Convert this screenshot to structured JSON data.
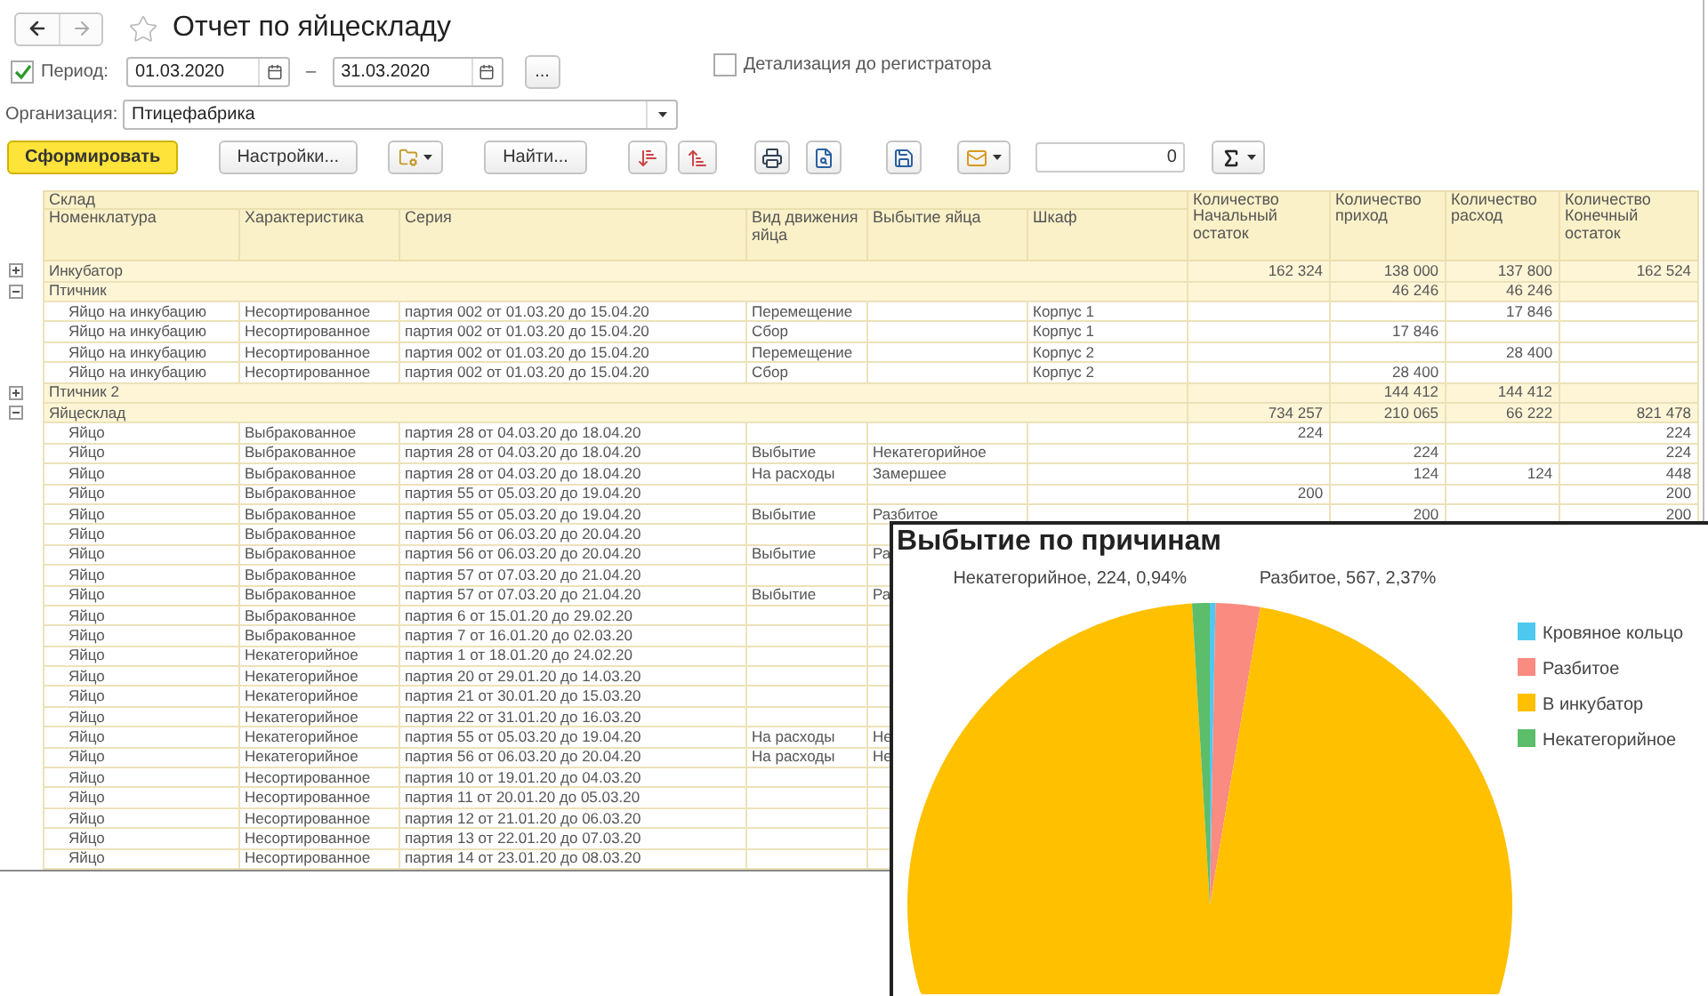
{
  "window": {
    "title": "Отчет по яйцескладу"
  },
  "period": {
    "label": "Период:",
    "checked": true,
    "from": "01.03.2020",
    "separator": "–",
    "to": "31.03.2020",
    "more_button": "..."
  },
  "detail_to_registrar": {
    "label": "Детализация до регистратора",
    "checked": false
  },
  "organization": {
    "label": "Организация:",
    "value": "Птицефабрика"
  },
  "toolbar": {
    "generate": "Сформировать",
    "settings": "Настройки...",
    "find": "Найти...",
    "sum_field": "0"
  },
  "table": {
    "group_header": "Склад",
    "columns": [
      "Номенклатура",
      "Характеристика",
      "Серия",
      "Вид движения яйца",
      "Выбытие яйца",
      "Шкаф",
      "Количество Начальный остаток",
      "Количество приход",
      "Количество расход",
      "Количество Конечный остаток"
    ],
    "rows": [
      {
        "kind": "group",
        "label": "Инкубатор",
        "expanded": false,
        "qty_start": "162 324",
        "qty_in": "138 000",
        "qty_out": "137 800",
        "qty_end": "162 524"
      },
      {
        "kind": "group",
        "label": "Птичник",
        "expanded": true,
        "qty_in": "46 246",
        "qty_out": "46 246"
      },
      {
        "kind": "item",
        "nomenclature": "Яйцо на инкубацию",
        "characteristic": "Несортированное",
        "series": "партия  002 от 01.03.20 до 15.04.20",
        "movement": "Перемещение",
        "cabinet": "Корпус 1",
        "qty_out": "17 846"
      },
      {
        "kind": "item",
        "nomenclature": "Яйцо на инкубацию",
        "characteristic": "Несортированное",
        "series": "партия  002 от 01.03.20 до 15.04.20",
        "movement": "Сбор",
        "cabinet": "Корпус 1",
        "qty_in": "17 846"
      },
      {
        "kind": "item",
        "nomenclature": "Яйцо на инкубацию",
        "characteristic": "Несортированное",
        "series": "партия  002 от 01.03.20 до 15.04.20",
        "movement": "Перемещение",
        "cabinet": "Корпус 2",
        "qty_out": "28 400"
      },
      {
        "kind": "item",
        "nomenclature": "Яйцо на инкубацию",
        "characteristic": "Несортированное",
        "series": "партия  002 от 01.03.20 до 15.04.20",
        "movement": "Сбор",
        "cabinet": "Корпус 2",
        "qty_in": "28 400"
      },
      {
        "kind": "group",
        "label": "Птичник 2",
        "expanded": false,
        "qty_in": "144 412",
        "qty_out": "144 412"
      },
      {
        "kind": "group",
        "label": "Яйцесклад",
        "expanded": true,
        "qty_start": "734 257",
        "qty_in": "210 065",
        "qty_out": "66 222",
        "qty_end": "821 478"
      },
      {
        "kind": "item",
        "nomenclature": "Яйцо",
        "characteristic": "Выбракованное",
        "series": "партия 28 от 04.03.20 до 18.04.20",
        "qty_start": "224",
        "qty_end": "224"
      },
      {
        "kind": "item",
        "nomenclature": "Яйцо",
        "characteristic": "Выбракованное",
        "series": "партия 28 от 04.03.20 до 18.04.20",
        "movement": "Выбытие",
        "disposal": "Некатегорийное",
        "qty_in": "224",
        "qty_end": "224"
      },
      {
        "kind": "item",
        "nomenclature": "Яйцо",
        "characteristic": "Выбракованное",
        "series": "партия 28 от 04.03.20 до 18.04.20",
        "movement": "На расходы",
        "disposal": "Замершее",
        "qty_in": "124",
        "qty_out": "124",
        "qty_end": "448"
      },
      {
        "kind": "item",
        "nomenclature": "Яйцо",
        "characteristic": "Выбракованное",
        "series": "партия 55 от 05.03.20 до 19.04.20",
        "qty_start": "200",
        "qty_end": "200"
      },
      {
        "kind": "item",
        "nomenclature": "Яйцо",
        "characteristic": "Выбракованное",
        "series": "партия 55 от 05.03.20 до 19.04.20",
        "movement": "Выбытие",
        "disposal": "Разбитое",
        "qty_in": "200",
        "qty_end": "200"
      },
      {
        "kind": "item",
        "nomenclature": "Яйцо",
        "characteristic": "Выбракованное",
        "series": "партия 56 от 06.03.20 до 20.04.20"
      },
      {
        "kind": "item",
        "nomenclature": "Яйцо",
        "characteristic": "Выбракованное",
        "series": "партия 56 от 06.03.20 до 20.04.20",
        "movement": "Выбытие",
        "disposal": "Ра"
      },
      {
        "kind": "item",
        "nomenclature": "Яйцо",
        "characteristic": "Выбракованное",
        "series": "партия 57 от 07.03.20 до 21.04.20"
      },
      {
        "kind": "item",
        "nomenclature": "Яйцо",
        "characteristic": "Выбракованное",
        "series": "партия 57 от 07.03.20 до 21.04.20",
        "movement": "Выбытие",
        "disposal": "Ра"
      },
      {
        "kind": "item",
        "nomenclature": "Яйцо",
        "characteristic": "Выбракованное",
        "series": "партия 6 от 15.01.20 до 29.02.20"
      },
      {
        "kind": "item",
        "nomenclature": "Яйцо",
        "characteristic": "Выбракованное",
        "series": "партия 7 от 16.01.20 до 02.03.20"
      },
      {
        "kind": "item",
        "nomenclature": "Яйцо",
        "characteristic": "Некатегорийное",
        "series": "партия 1 от 18.01.20 до 24.02.20"
      },
      {
        "kind": "item",
        "nomenclature": "Яйцо",
        "characteristic": "Некатегорийное",
        "series": "партия 20 от 29.01.20 до 14.03.20"
      },
      {
        "kind": "item",
        "nomenclature": "Яйцо",
        "characteristic": "Некатегорийное",
        "series": "партия 21 от 30.01.20 до 15.03.20"
      },
      {
        "kind": "item",
        "nomenclature": "Яйцо",
        "characteristic": "Некатегорийное",
        "series": "партия 22 от 31.01.20 до 16.03.20"
      },
      {
        "kind": "item",
        "nomenclature": "Яйцо",
        "characteristic": "Некатегорийное",
        "series": "партия 55 от 05.03.20 до 19.04.20",
        "movement": "На расходы",
        "disposal": "Не"
      },
      {
        "kind": "item",
        "nomenclature": "Яйцо",
        "characteristic": "Некатегорийное",
        "series": "партия 56 от 06.03.20 до 20.04.20",
        "movement": "На расходы",
        "disposal": "Не"
      },
      {
        "kind": "item",
        "nomenclature": "Яйцо",
        "characteristic": "Несортированное",
        "series": "партия 10 от 19.01.20 до 04.03.20"
      },
      {
        "kind": "item",
        "nomenclature": "Яйцо",
        "characteristic": "Несортированное",
        "series": "партия 11 от 20.01.20 до 05.03.20"
      },
      {
        "kind": "item",
        "nomenclature": "Яйцо",
        "characteristic": "Несортированное",
        "series": "партия 12 от 21.01.20 до 06.03.20"
      },
      {
        "kind": "item",
        "nomenclature": "Яйцо",
        "characteristic": "Несортированное",
        "series": "партия 13 от 22.01.20 до 07.03.20"
      },
      {
        "kind": "item",
        "nomenclature": "Яйцо",
        "characteristic": "Несортированное",
        "series": "партия 14 от 23.01.20 до 08.03.20"
      }
    ]
  },
  "chart": {
    "chart_data": {
      "type": "pie",
      "title": "Выбытие по причинам",
      "categories": [
        "Кровяное кольцо",
        "Разбитое",
        "В инкубатор",
        "Некатегорийное"
      ],
      "values": [
        0.3,
        2.37,
        96.39,
        0.94
      ],
      "colors": [
        "#4fc8f0",
        "#f98b80",
        "#ffc000",
        "#5cbd6a"
      ],
      "value_labels": [
        null,
        "Разбитое, 567, 2,37%",
        null,
        "Некатегорийное, 224, 0,94%"
      ],
      "legend": true
    }
  }
}
